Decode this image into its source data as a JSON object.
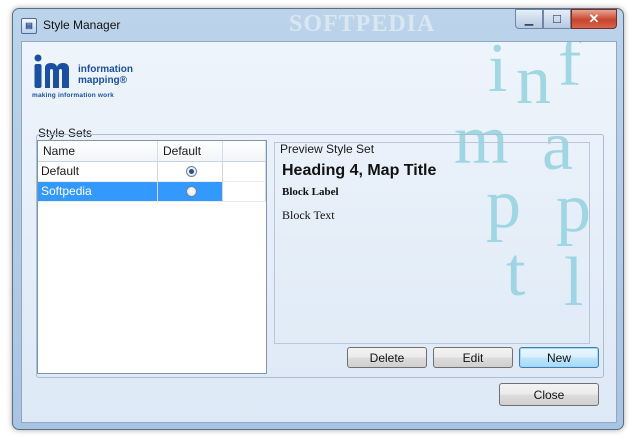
{
  "window": {
    "title": "Style Manager",
    "watermark": "SOFTPEDIA",
    "app_icon": "document-icon"
  },
  "caption_buttons": {
    "minimize": "minimize-icon",
    "maximize": "maximize-icon",
    "close": "close-icon"
  },
  "logo": {
    "line1": "information",
    "line2": "mapping®",
    "tagline": "making information work"
  },
  "style_sets": {
    "group_label": "Style Sets",
    "columns": [
      "Name",
      "Default"
    ],
    "rows": [
      {
        "name": "Default",
        "is_default": true,
        "selected": false
      },
      {
        "name": "Softpedia",
        "is_default": false,
        "selected": true
      }
    ]
  },
  "preview": {
    "label": "Preview Style Set",
    "heading": "Heading 4, Map Title",
    "block_label": "Block Label",
    "block_text": "Block Text"
  },
  "buttons": {
    "delete": "Delete",
    "edit": "Edit",
    "new": "New",
    "close": "Close"
  },
  "colors": {
    "selection": "#3399ff",
    "brand": "#1b4f9f",
    "deco": "#8fd0de"
  }
}
